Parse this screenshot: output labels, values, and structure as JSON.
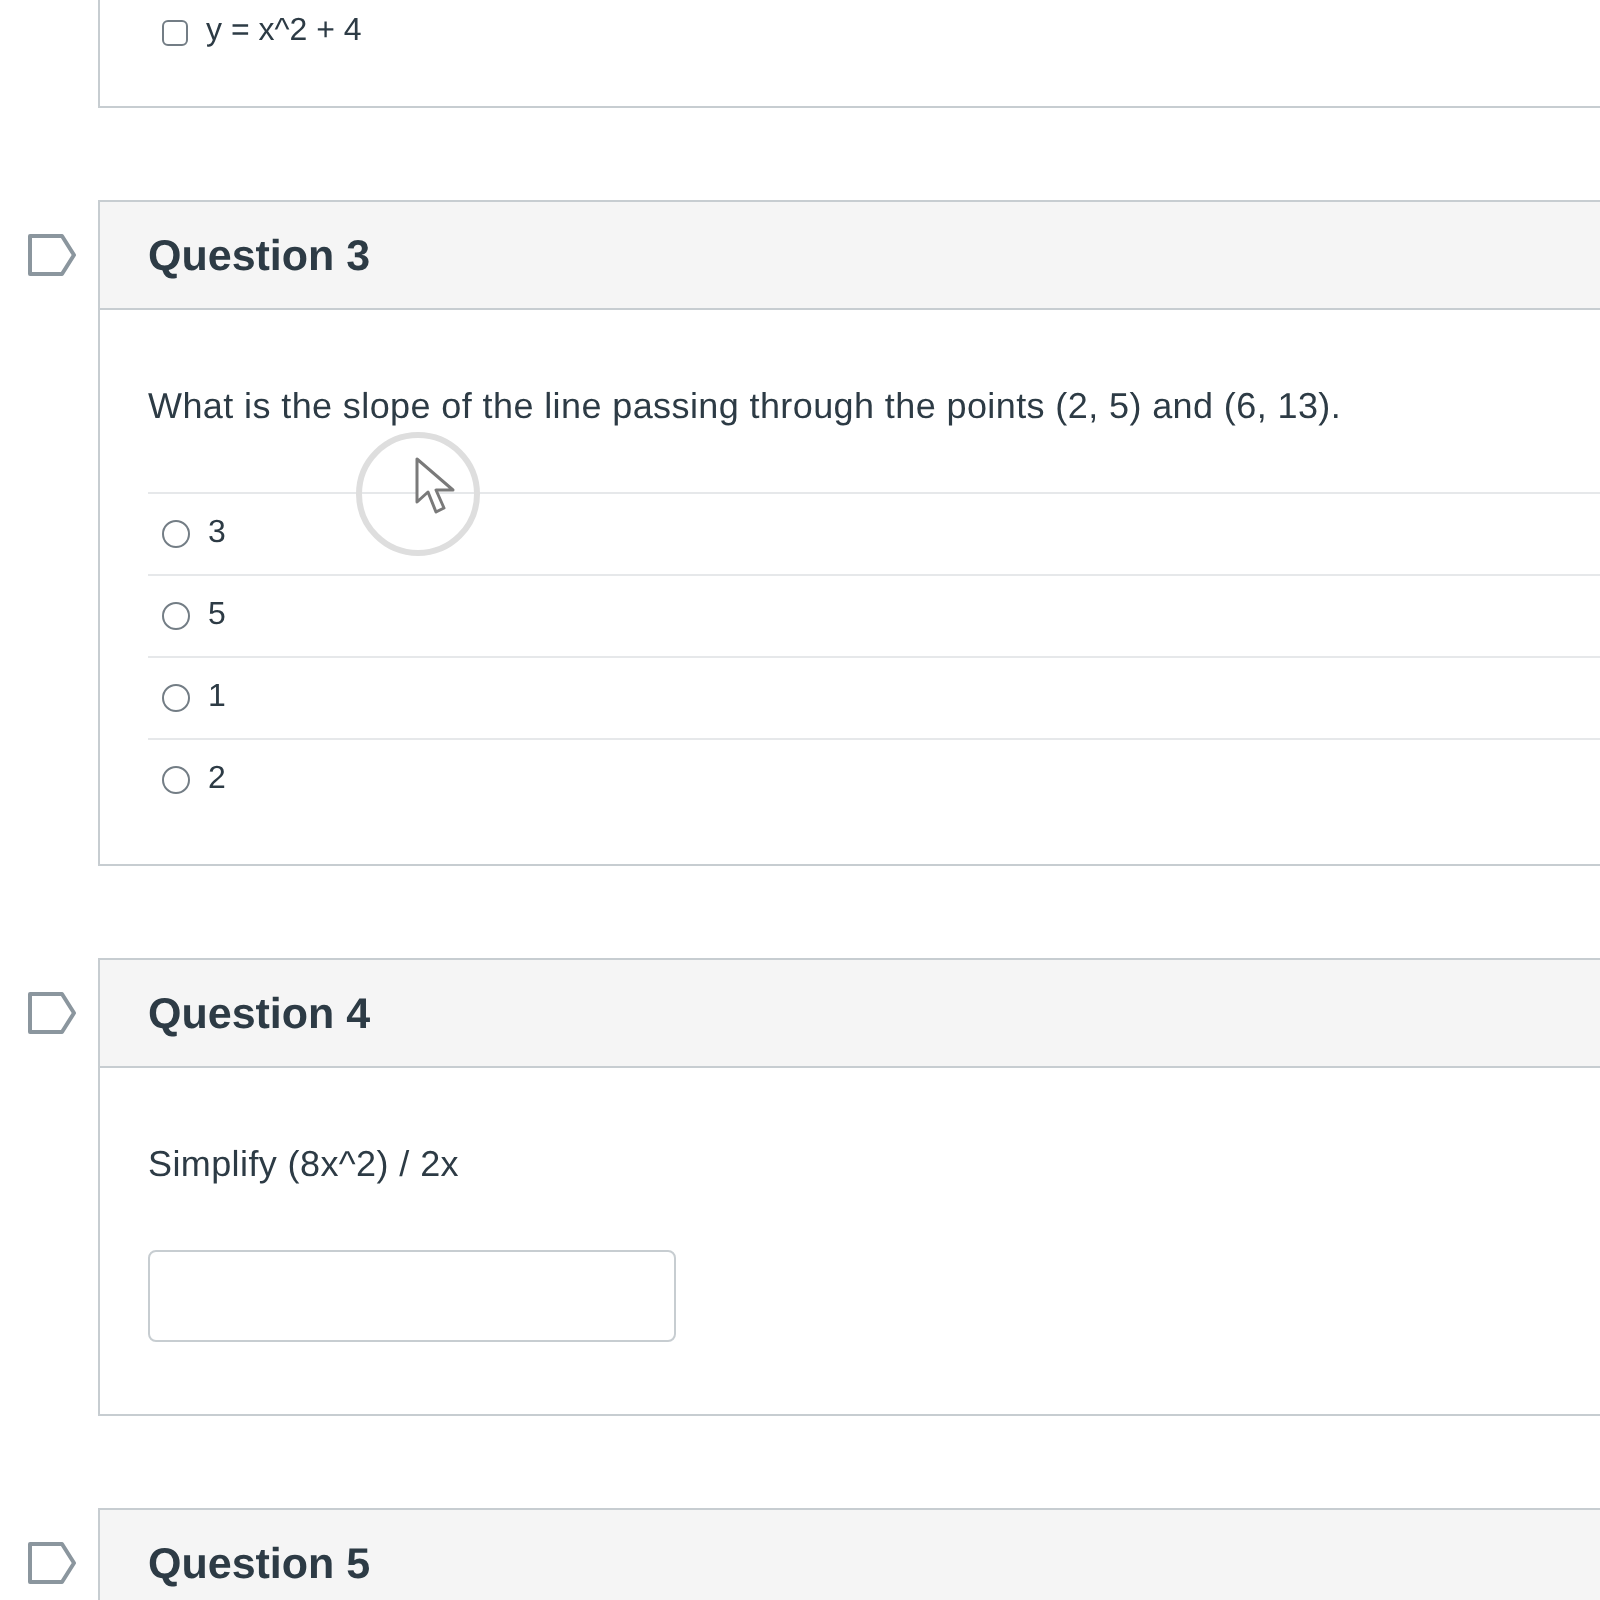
{
  "previous_question": {
    "answers": [
      {
        "label": "y = x^2 + 4",
        "checked": false
      }
    ]
  },
  "questions": [
    {
      "title": "Question 3",
      "flagged": false,
      "kind": "multiple_choice",
      "text": "What is the slope of the line passing through the points (2, 5) and (6, 13).",
      "answers": [
        {
          "label": "3",
          "selected": false
        },
        {
          "label": "5",
          "selected": false
        },
        {
          "label": "1",
          "selected": false
        },
        {
          "label": "2",
          "selected": false
        }
      ]
    },
    {
      "title": "Question 4",
      "flagged": false,
      "kind": "short_answer",
      "text": "Simplify (8x^2) / 2x"
    },
    {
      "title": "Question 5",
      "flagged": false
    }
  ]
}
